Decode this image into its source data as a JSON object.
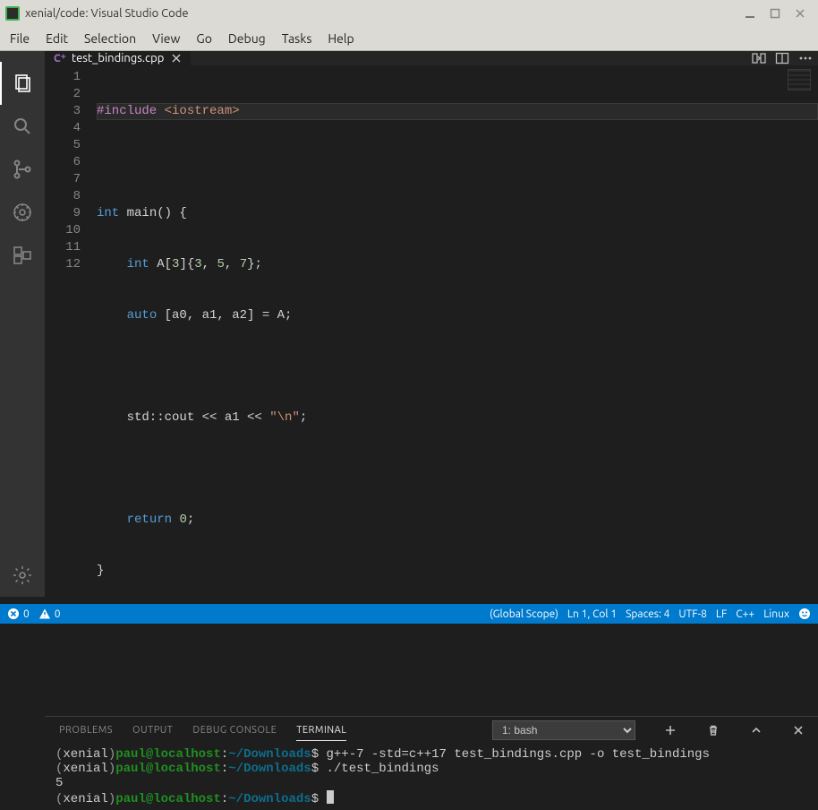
{
  "window": {
    "title": "xenial/code: Visual Studio Code"
  },
  "menubar": [
    "File",
    "Edit",
    "Selection",
    "View",
    "Go",
    "Debug",
    "Tasks",
    "Help"
  ],
  "tabs": {
    "file": "test_bindings.cpp"
  },
  "gutter": [
    "1",
    "2",
    "3",
    "4",
    "5",
    "6",
    "7",
    "8",
    "9",
    "10",
    "11",
    "12"
  ],
  "code": {
    "l1_include": "#include",
    "l1_header": "<iostream>",
    "l3_int": "int",
    "l3_main": " main() {",
    "l4_pad": "    ",
    "l4_int": "int",
    "l4_a": " A[",
    "l4_3a": "3",
    "l4_b": "]{",
    "l4_3b": "3",
    "l4_c": ", ",
    "l4_5": "5",
    "l4_d": ", ",
    "l4_7": "7",
    "l4_e": "};",
    "l5_pad": "    ",
    "l5_auto": "auto",
    "l5_rest": " [a0, a1, a2] = A;",
    "l7_pad": "    std::cout << a1 << ",
    "l7_str": "\"\\n\"",
    "l7_end": ";",
    "l9_pad": "    ",
    "l9_ret": "return",
    "l9_sp": " ",
    "l9_zero": "0",
    "l9_end": ";",
    "l10": "}"
  },
  "panel": {
    "tabs": {
      "problems": "PROBLEMS",
      "output": "OUTPUT",
      "debug": "DEBUG CONSOLE",
      "terminal": "TERMINAL"
    },
    "shell": "1: bash"
  },
  "terminal": {
    "env": "xenial",
    "user": "paul@localhost",
    "path": "~/Downloads",
    "cmd1": "g++-7 -std=c++17 test_bindings.cpp -o test_bindings",
    "cmd2": "./test_bindings",
    "out": "5"
  },
  "status": {
    "errors": "0",
    "warnings": "0",
    "scope": "(Global Scope)",
    "pos": "Ln 1, Col 1",
    "spaces": "Spaces: 4",
    "enc": "UTF-8",
    "eol": "LF",
    "lang": "C++",
    "os": "Linux"
  }
}
